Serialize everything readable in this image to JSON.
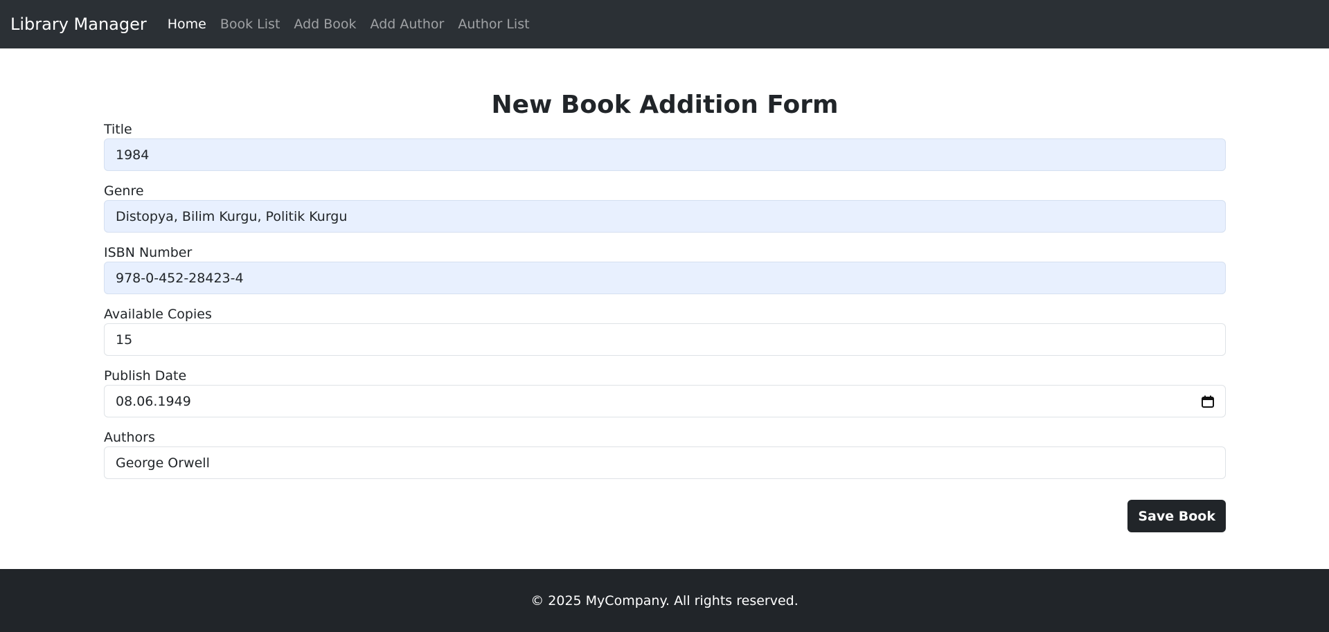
{
  "navbar": {
    "brand": "Library Manager",
    "links": [
      {
        "label": "Home",
        "active": true
      },
      {
        "label": "Book List",
        "active": false
      },
      {
        "label": "Add Book",
        "active": false
      },
      {
        "label": "Add Author",
        "active": false
      },
      {
        "label": "Author List",
        "active": false
      }
    ]
  },
  "form": {
    "title": "New Book Addition Form",
    "fields": {
      "title": {
        "label": "Title",
        "value": "1984"
      },
      "genre": {
        "label": "Genre",
        "value": "Distopya, Bilim Kurgu, Politik Kurgu"
      },
      "isbn": {
        "label": "ISBN Number",
        "value": "978-0-452-28423-4"
      },
      "copies": {
        "label": "Available Copies",
        "value": "15"
      },
      "publish_date": {
        "label": "Publish Date",
        "value": "08.06.1949"
      },
      "authors": {
        "label": "Authors",
        "value": "George Orwell"
      }
    },
    "save_label": "Save Book"
  },
  "footer": {
    "text": "© 2025 MyCompany. All rights reserved."
  },
  "colors": {
    "navbar_bg": "#2b3035",
    "footer_bg": "#212529",
    "autofill_bg": "#e8f0fe",
    "button_bg": "#212529"
  },
  "icons": {
    "date": "calendar-icon"
  }
}
